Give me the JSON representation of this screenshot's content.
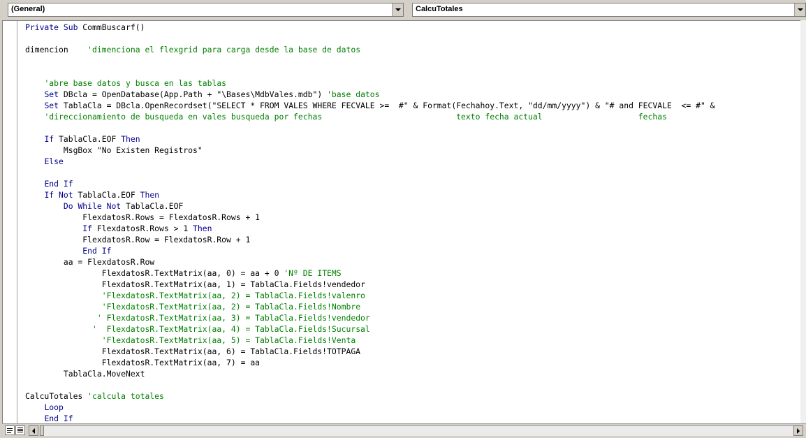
{
  "object_combo": {
    "value": "(General)"
  },
  "procedure_combo": {
    "value": "CalcuTotales"
  },
  "colors": {
    "keyword": "#00008b",
    "comment": "#007f00",
    "text": "#000000"
  },
  "code_lines": [
    [
      [
        "k",
        "Private Sub "
      ],
      [
        "t",
        "CommBuscarf()"
      ]
    ],
    [],
    [
      [
        "t",
        "dimencion    "
      ],
      [
        "c",
        "'dimenciona el flexgrid para carga desde la base de datos"
      ]
    ],
    [],
    [],
    [
      [
        "t",
        "    "
      ],
      [
        "c",
        "'abre base datos y busca en las tablas"
      ]
    ],
    [
      [
        "t",
        "    "
      ],
      [
        "k",
        "Set "
      ],
      [
        "t",
        "DBcla = OpenDatabase(App.Path + \"\\Bases\\MdbVales.mdb\") "
      ],
      [
        "c",
        "'base datos"
      ]
    ],
    [
      [
        "t",
        "    "
      ],
      [
        "k",
        "Set "
      ],
      [
        "t",
        "TablaCla = DBcla.OpenRecordset(\"SELECT * FROM VALES WHERE FECVALE >=  #\" & Format(Fechahoy.Text, \"dd/mm/yyyy\") & \"# and FECVALE  <= #\" &"
      ]
    ],
    [
      [
        "t",
        "    "
      ],
      [
        "c",
        "'direccionamiento de busqueda en vales busqueda por fechas                            texto fecha actual                    fechas"
      ]
    ],
    [],
    [
      [
        "t",
        "    "
      ],
      [
        "k",
        "If "
      ],
      [
        "t",
        "TablaCla.EOF "
      ],
      [
        "k",
        "Then"
      ]
    ],
    [
      [
        "t",
        "        MsgBox \"No Existen Registros\""
      ]
    ],
    [
      [
        "t",
        "    "
      ],
      [
        "k",
        "Else"
      ]
    ],
    [],
    [
      [
        "t",
        "    "
      ],
      [
        "k",
        "End If"
      ]
    ],
    [
      [
        "t",
        "    "
      ],
      [
        "k",
        "If Not "
      ],
      [
        "t",
        "TablaCla.EOF "
      ],
      [
        "k",
        "Then"
      ]
    ],
    [
      [
        "t",
        "        "
      ],
      [
        "k",
        "Do While Not "
      ],
      [
        "t",
        "TablaCla.EOF"
      ]
    ],
    [
      [
        "t",
        "            FlexdatosR.Rows = FlexdatosR.Rows + 1"
      ]
    ],
    [
      [
        "t",
        "            "
      ],
      [
        "k",
        "If "
      ],
      [
        "t",
        "FlexdatosR.Rows > 1 "
      ],
      [
        "k",
        "Then"
      ]
    ],
    [
      [
        "t",
        "            FlexdatosR.Row = FlexdatosR.Row + 1"
      ]
    ],
    [
      [
        "t",
        "            "
      ],
      [
        "k",
        "End If"
      ]
    ],
    [
      [
        "t",
        "        aa = FlexdatosR.Row"
      ]
    ],
    [
      [
        "t",
        "                FlexdatosR.TextMatrix(aa, 0) = aa + 0 "
      ],
      [
        "c",
        "'Nº DE ITEMS"
      ]
    ],
    [
      [
        "t",
        "                FlexdatosR.TextMatrix(aa, 1) = TablaCla.Fields!vendedor"
      ]
    ],
    [
      [
        "t",
        "                "
      ],
      [
        "c",
        "'FlexdatosR.TextMatrix(aa, 2) = TablaCla.Fields!valenro"
      ]
    ],
    [
      [
        "t",
        "                "
      ],
      [
        "c",
        "'FlexdatosR.TextMatrix(aa, 2) = TablaCla.Fields!Nombre"
      ]
    ],
    [
      [
        "t",
        "               "
      ],
      [
        "c",
        "' FlexdatosR.TextMatrix(aa, 3) = TablaCla.Fields!vendedor"
      ]
    ],
    [
      [
        "t",
        "              "
      ],
      [
        "c",
        "'  FlexdatosR.TextMatrix(aa, 4) = TablaCla.Fields!Sucursal"
      ]
    ],
    [
      [
        "t",
        "                "
      ],
      [
        "c",
        "'FlexdatosR.TextMatrix(aa, 5) = TablaCla.Fields!Venta"
      ]
    ],
    [
      [
        "t",
        "                FlexdatosR.TextMatrix(aa, 6) = TablaCla.Fields!TOTPAGA"
      ]
    ],
    [
      [
        "t",
        "                FlexdatosR.TextMatrix(aa, 7) = aa"
      ]
    ],
    [
      [
        "t",
        "        TablaCla.MoveNext"
      ]
    ],
    [],
    [
      [
        "t",
        "CalcuTotales "
      ],
      [
        "c",
        "'calcula totales"
      ]
    ],
    [
      [
        "t",
        "    "
      ],
      [
        "k",
        "Loop"
      ]
    ],
    [
      [
        "t",
        "    "
      ],
      [
        "k",
        "End If"
      ]
    ]
  ],
  "icons": {
    "dropdown": "chevron-down-icon",
    "procedure_view": "procedure-view-icon",
    "module_view": "full-module-view-icon",
    "scroll_left": "scroll-left-arrow-icon",
    "scroll_right": "scroll-right-arrow-icon"
  }
}
